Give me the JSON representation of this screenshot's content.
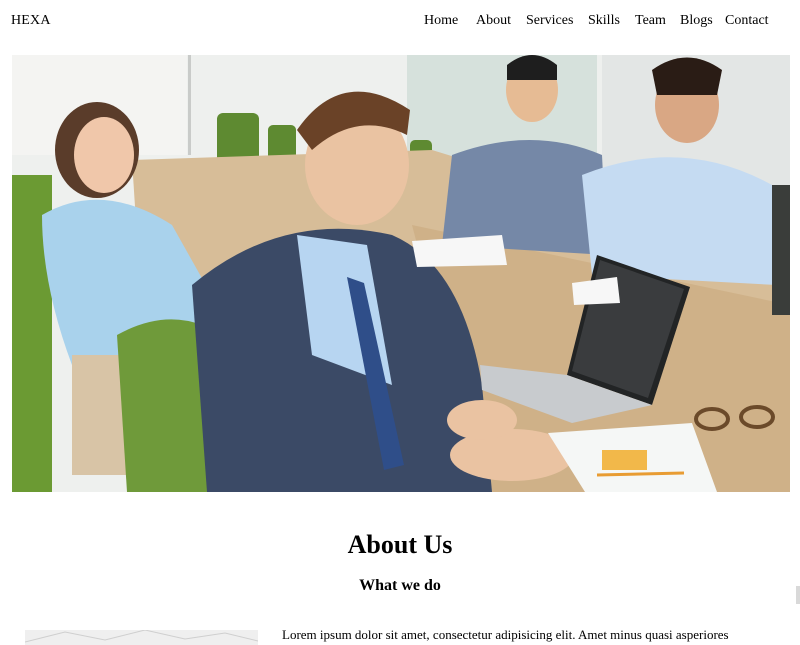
{
  "brand": "HEXA",
  "nav": {
    "items": [
      "Home",
      "About",
      "Services",
      "Skills",
      "Team",
      "Blogs",
      "Contact"
    ]
  },
  "hero": {
    "image_icon": "business-team-meeting-photo"
  },
  "about": {
    "title": "About Us",
    "subtitle": "What we do",
    "paragraph": "Lorem ipsum dolor sit amet, consectetur adipisicing elit. Amet minus quasi asperiores"
  },
  "colors": {
    "text": "#000000",
    "background": "#ffffff",
    "chair_green": "#6f9a3a",
    "suit_navy": "#3b4a66",
    "table_wood": "#d2b58f"
  }
}
